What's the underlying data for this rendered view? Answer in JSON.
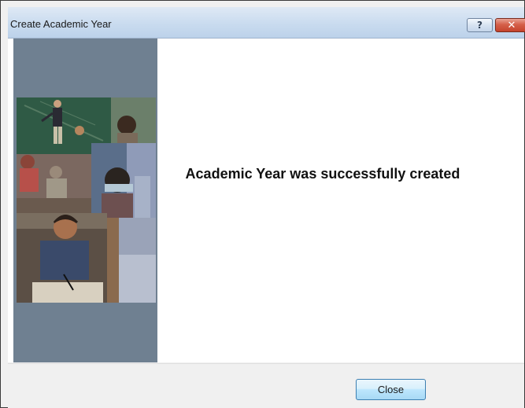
{
  "window": {
    "title": "Create Academic Year",
    "help_glyph": "?",
    "close_glyph": "✕"
  },
  "main": {
    "message": "Academic Year was successfully created"
  },
  "footer": {
    "close_label": "Close"
  },
  "colors": {
    "sidebar": "#6f8091",
    "titlebar": "#c9dbef",
    "close_button_border": "#3c7fb1"
  },
  "icons": {
    "help": "question-mark-icon",
    "close": "close-icon"
  }
}
